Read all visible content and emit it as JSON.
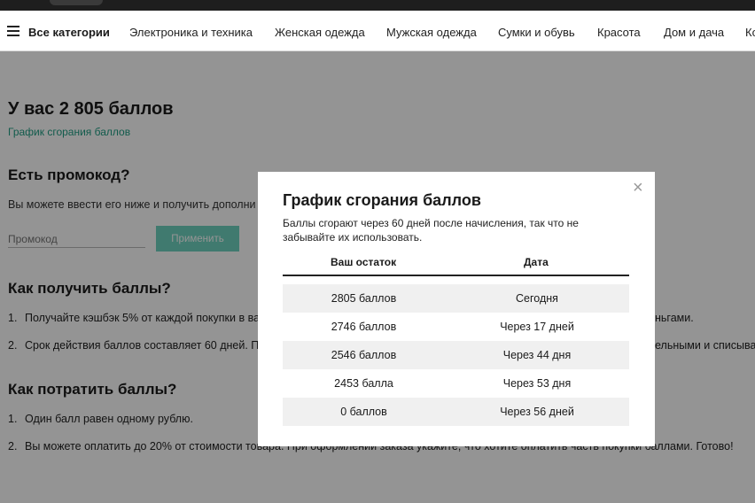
{
  "nav": {
    "all_categories": "Все категории",
    "categories": [
      "Электроника и техника",
      "Женская одежда",
      "Мужская одежда",
      "Сумки и обувь",
      "Красота",
      "Дом и дача",
      "Ко"
    ]
  },
  "page": {
    "balance_title": "У вас 2 805 баллов",
    "schedule_link": "График сгорания баллов",
    "promo_heading": "Есть промокод?",
    "promo_desc": "Вы можете ввести его ниже и получить дополни",
    "promo_placeholder": "Промокод",
    "apply_label": "Применить",
    "earn_heading": "Как получить баллы?",
    "earn_items": [
      {
        "num": "1.",
        "text": "Получайте кэшбэк 5% от каждой покупки в ва",
        "tail": "ньгами."
      },
      {
        "num": "2.",
        "text": "Срок действия баллов составляет 60 дней. П",
        "tail": "ельными и списыва"
      }
    ],
    "spend_heading": "Как потратить баллы?",
    "spend_items": [
      {
        "num": "1.",
        "text": "Один балл равен одному рублю."
      },
      {
        "num": "2.",
        "text": "Вы можете оплатить до 20% от стоимости товара. При оформлении заказа укажите, что хотите оплатить часть покупки баллами. Готово!"
      }
    ]
  },
  "modal": {
    "close_glyph": "×",
    "title": "График сгорания баллов",
    "description": "Баллы сгорают через 60 дней после начисления, так что не забывайте их использовать.",
    "col_balance": "Ваш остаток",
    "col_date": "Дата",
    "rows": [
      {
        "balance": "2805 баллов",
        "date": "Сегодня"
      },
      {
        "balance": "2746 баллов",
        "date": "Через 17 дней"
      },
      {
        "balance": "2546 баллов",
        "date": "Через 44 дня"
      },
      {
        "balance": "2453 балла",
        "date": "Через 53 дня"
      },
      {
        "balance": "0 баллов",
        "date": "Через 56 дней"
      }
    ]
  },
  "colors": {
    "accent": "#1f9e84",
    "button": "#6fd3bf",
    "overlay": "rgba(0,0,0,0.42)"
  }
}
